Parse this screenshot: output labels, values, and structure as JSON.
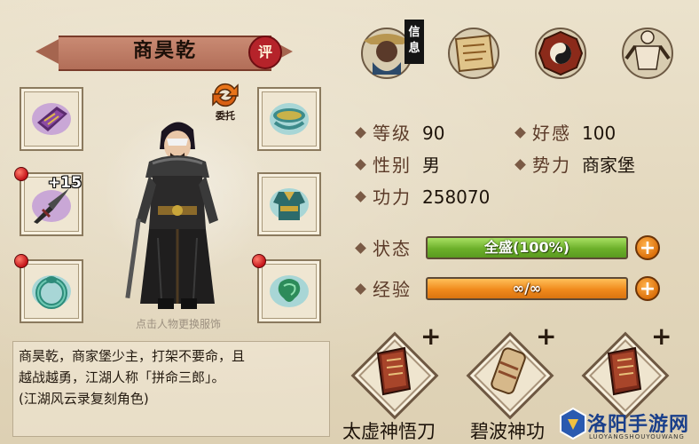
{
  "character": {
    "name": "商昊乾",
    "rate_label": "评",
    "commission_label": "委托",
    "hint": "点击人物更换服饰"
  },
  "equipment": {
    "weapon_enhance": "+15"
  },
  "top_tabs": {
    "info_label": "信息"
  },
  "stats": {
    "level_label": "等级",
    "level_value": "90",
    "favor_label": "好感",
    "favor_value": "100",
    "gender_label": "性别",
    "gender_value": "男",
    "faction_label": "势力",
    "faction_value": "商家堡",
    "power_label": "功力",
    "power_value": "258070"
  },
  "status": {
    "label": "状态",
    "bar_text": "全盛(100%)",
    "fill_fraction": 1.0,
    "plus": "+"
  },
  "exp": {
    "label": "经验",
    "bar_text": "∞/∞",
    "fill_fraction": 1.0,
    "plus": "+"
  },
  "description": {
    "lines": [
      "商昊乾，商家堡少主，打架不要命，且",
      "越战越勇，江湖人称「拼命三郎」。",
      "(江湖风云录复刻角色)"
    ]
  },
  "skills": [
    {
      "name": "太虚神悟刀",
      "add": "+"
    },
    {
      "name": "碧波神功",
      "add": "+"
    },
    {
      "name": "",
      "add": "+"
    }
  ],
  "watermark": {
    "text": "洛阳手游网",
    "sub": "LUOYANGSHOUYOUWANG"
  },
  "colors": {
    "banner": "#b26e58",
    "status_bar": "#6cb02a",
    "exp_bar": "#f08a1c",
    "red_dot": "#c4141a"
  }
}
